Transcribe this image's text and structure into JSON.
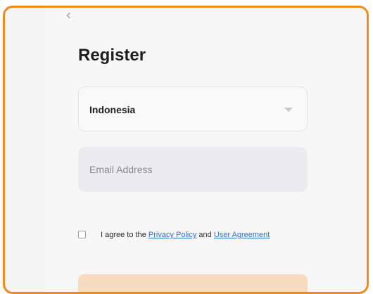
{
  "form": {
    "title": "Register",
    "country": {
      "selected": "Indonesia"
    },
    "email": {
      "placeholder": "Email Address"
    },
    "agreement": {
      "prefix": "I agree to the ",
      "privacy_link": "Privacy Policy",
      "middle": " and ",
      "user_link": "User Agreement"
    }
  },
  "colors": {
    "accent": "#ef8a1f",
    "link": "#2f6fd6",
    "button_disabled": "#f8dcc0"
  },
  "icons": [
    "chevron-left-icon",
    "caret-down-icon",
    "checkbox-icon"
  ]
}
